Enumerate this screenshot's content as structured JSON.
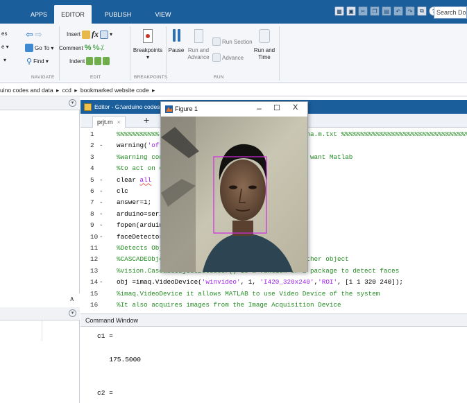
{
  "toolbar": {
    "tabs": [
      "APPS",
      "EDITOR",
      "PUBLISH",
      "VIEW"
    ],
    "active_tab": "EDITOR",
    "search_placeholder": "Search Docu",
    "navigate": {
      "clipped_es": "es",
      "clipped_e": "e ▾",
      "clipped_arrow": "▾",
      "goto_label": "Go To ▾",
      "find_label": "Find ▾",
      "group_label": "NAVIGATE"
    },
    "edit": {
      "insert_label": "Insert",
      "comment_label": "Comment",
      "indent_label": "Indent",
      "fx_label": "fx",
      "group_label": "EDIT"
    },
    "breakpoints": {
      "button_label": "Breakpoints",
      "group_label": "BREAKPOINTS"
    },
    "run": {
      "pause_label": "Pause",
      "run_advance_line1": "Run and",
      "run_advance_line2": "Advance",
      "run_section_label": "Run Section",
      "advance_label": "Advance",
      "run_time_line1": "Run and",
      "run_time_line2": "Time",
      "group_label": "RUN"
    }
  },
  "address": {
    "crumbs": [
      "uino codes and data",
      "ccd",
      "bookmarked website code"
    ],
    "sep": "▸"
  },
  "editor": {
    "title": "Editor - G:\\arduino codes a",
    "file_tab": "prjt.m",
    "close_glyph": "×",
    "add_glyph": "+",
    "lines": [
      {
        "n": "1",
        "dash": "",
        "parts": [
          {
            "t": "%%%%%%%%%%%",
            "c": "cm"
          },
          {
            "t": "                                 ",
            "c": ""
          },
          {
            "t": "% maina.m.txt %%%%%%%%%%%%%%%%%%%%%%%%%%%%%%%%%%%",
            "c": "cm"
          }
        ]
      },
      {
        "n": "2",
        "dash": "-",
        "parts": [
          {
            "t": "warning(",
            "c": ""
          },
          {
            "t": "'off",
            "c": "st"
          },
          {
            "t": "                               )",
            "c": ""
          }
        ]
      },
      {
        "n": "3",
        "dash": "",
        "parts": [
          {
            "t": "%warning con",
            "c": "cm"
          },
          {
            "t": "                              ",
            "c": ""
          },
          {
            "t": "e how u want Matlab",
            "c": "cm"
          }
        ]
      },
      {
        "n": "4",
        "dash": "",
        "parts": [
          {
            "t": "%to act on c",
            "c": "cm"
          }
        ]
      },
      {
        "n": "5",
        "dash": "-",
        "parts": [
          {
            "t": "clear ",
            "c": ""
          },
          {
            "t": "all",
            "c": "st ul"
          }
        ]
      },
      {
        "n": "6",
        "dash": "-",
        "parts": [
          {
            "t": "clc",
            "c": ""
          }
        ]
      },
      {
        "n": "7",
        "dash": "-",
        "parts": [
          {
            "t": "answer=1;",
            "c": ""
          }
        ]
      },
      {
        "n": "8",
        "dash": "-",
        "parts": [
          {
            "t": "arduino=seri",
            "c": ""
          }
        ]
      },
      {
        "n": "9",
        "dash": "-",
        "parts": [
          {
            "t": "fopen(arduin",
            "c": ""
          }
        ]
      },
      {
        "n": "10",
        "dash": "-",
        "parts": [
          {
            "t": "faceDetector",
            "c": ""
          }
        ]
      },
      {
        "n": "11",
        "dash": "",
        "parts": [
          {
            "t": "%Detects Obj",
            "c": "cm"
          }
        ]
      },
      {
        "n": "12",
        "dash": "",
        "parts": [
          {
            "t": "%CASCADEObje",
            "c": "cm"
          },
          {
            "t": "                              ",
            "c": ""
          },
          {
            "t": "on of other object",
            "c": "cm"
          }
        ]
      },
      {
        "n": "13",
        "dash": "",
        "parts": [
          {
            "t": "%vision.CascadeObjectDetector() is a funtion or a package to detect faces",
            "c": "cm"
          }
        ]
      },
      {
        "n": "14",
        "dash": "-",
        "parts": [
          {
            "t": "obj =imaq.VideoDevice(",
            "c": ""
          },
          {
            "t": "'winvideo'",
            "c": "st"
          },
          {
            "t": ", 1, ",
            "c": ""
          },
          {
            "t": "'I420_320x240'",
            "c": "st"
          },
          {
            "t": ",",
            "c": ""
          },
          {
            "t": "'ROI'",
            "c": "st"
          },
          {
            "t": ", [1 1 320 240]);",
            "c": ""
          }
        ]
      },
      {
        "n": "15",
        "dash": "",
        "parts": [
          {
            "t": "%imaq.VideoDevice it allows MATLAB to use Video Device of the system",
            "c": "cm"
          }
        ]
      },
      {
        "n": "16",
        "dash": "",
        "parts": [
          {
            "t": "%It also acquires images from the Image Acquisition Device",
            "c": "cm"
          }
        ]
      }
    ]
  },
  "command_window": {
    "title": "Command Window",
    "lines": [
      "c1 =",
      "",
      "  175.5000",
      "",
      "",
      "c2 ="
    ]
  },
  "figure": {
    "title": "Figure 1",
    "minimize": "–",
    "maximize": "☐",
    "close": "X"
  },
  "left": {
    "dropdown_glyph": "▾",
    "scroll_up": "∧"
  }
}
